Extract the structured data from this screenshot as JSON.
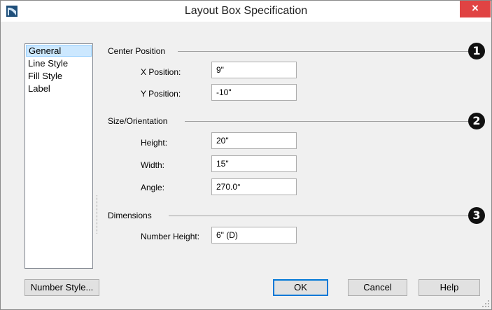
{
  "window": {
    "title": "Layout Box Specification",
    "close_glyph": "×"
  },
  "nav": {
    "items": [
      "General",
      "Line Style",
      "Fill Style",
      "Label"
    ],
    "selected": "General"
  },
  "groups": {
    "center_position": {
      "title": "Center Position",
      "callout": "1",
      "fields": [
        {
          "label": "X Position:",
          "value": "9\""
        },
        {
          "label": "Y Position:",
          "value": "-10\""
        }
      ]
    },
    "size_orientation": {
      "title": "Size/Orientation",
      "callout": "2",
      "fields": [
        {
          "label": "Height:",
          "value": "20\""
        },
        {
          "label": "Width:",
          "value": "15\""
        },
        {
          "label": "Angle:",
          "value": "270.0°"
        }
      ]
    },
    "dimensions": {
      "title": "Dimensions",
      "callout": "3",
      "fields": [
        {
          "label": "Number Height:",
          "value": "6\" (D)"
        }
      ]
    }
  },
  "buttons": {
    "number_style": "Number Style...",
    "ok": "OK",
    "cancel": "Cancel",
    "help": "Help"
  },
  "colors": {
    "close_red": "#e04343",
    "selected_bg": "#cce8ff",
    "default_button_border": "#0078d7",
    "callout_fill": "#111111"
  }
}
